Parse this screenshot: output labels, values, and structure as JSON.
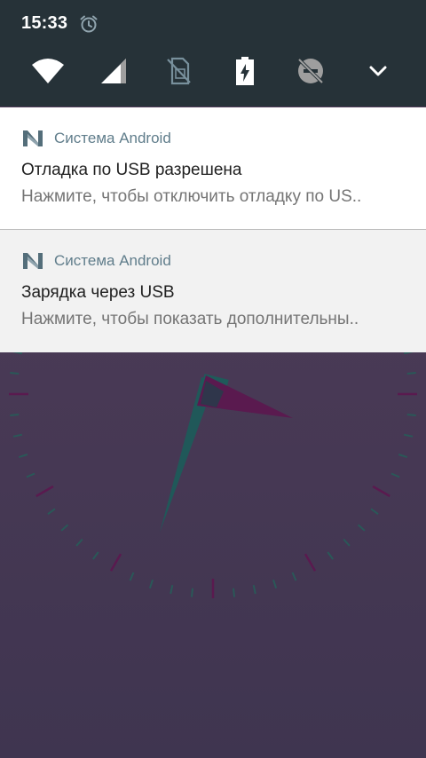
{
  "status_bar": {
    "time": "15:33",
    "alarm_icon": "alarm-clock-icon"
  },
  "quick_settings": {
    "tiles": [
      {
        "icon": "wifi-icon"
      },
      {
        "icon": "cellular-signal-icon"
      },
      {
        "icon": "no-sim-icon"
      },
      {
        "icon": "battery-charging-icon"
      },
      {
        "icon": "do-not-disturb-off-icon"
      },
      {
        "icon": "expand-chevron-icon"
      }
    ]
  },
  "notifications": [
    {
      "app_name": "Система Android",
      "title": "Отладка по USB разрешена",
      "text": "Нажмите, чтобы отключить отладку по US.."
    },
    {
      "app_name": "Система Android",
      "title": "Зарядка через USB",
      "text": "Нажмите, чтобы показать дополнительны.."
    }
  ],
  "colors": {
    "header_bg": "#263238",
    "notification_bg": "#ffffff",
    "notification_alt_bg": "#f2f2f2",
    "app_name": "#607d8b",
    "wallpaper": "#4a3a56",
    "minute_hand": "#1f5a5a",
    "hour_hand": "#5a1a4f"
  }
}
